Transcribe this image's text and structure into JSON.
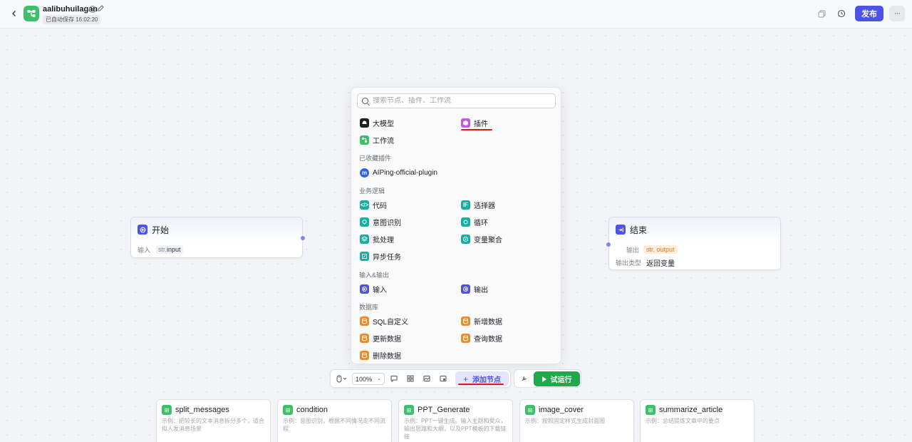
{
  "header": {
    "app_name": "aalibuhuilagan",
    "autosave": "已自动保存 16:02:20",
    "publish_label": "发布",
    "more_label": "···"
  },
  "colors": {
    "brand": "#4d53e8",
    "workflow_green": "#3ec06b",
    "run_green": "#20a84a",
    "annotation_red": "#e01818"
  },
  "start_node": {
    "title": "开始",
    "input_label": "输入",
    "input_type": "str.",
    "input_name": "input"
  },
  "end_node": {
    "title": "结束",
    "output_label": "输出",
    "output_tag": "output",
    "output_type_label": "输出类型",
    "output_type_value": "返回变量"
  },
  "popover": {
    "search_placeholder": "搜索节点、插件、工作流",
    "top_items": [
      {
        "label": "大模型",
        "icon": "llm-icon"
      },
      {
        "label": "插件",
        "icon": "plugin-icon"
      },
      {
        "label": "工作流",
        "icon": "workflow-icon"
      }
    ],
    "favorites_title": "已收藏插件",
    "favorite_plugin": "AIPing-official-plugin",
    "logic_title": "业务逻辑",
    "logic_items": [
      "代码",
      "选择器",
      "意图识别",
      "循环",
      "批处理",
      "变量聚合",
      "异步任务"
    ],
    "io_title": "输入&输出",
    "io_items": [
      "输入",
      "输出"
    ],
    "db_title": "数据库",
    "db_items": [
      "SQL自定义",
      "新增数据",
      "更新数据",
      "查询数据",
      "删除数据"
    ]
  },
  "toolbar": {
    "zoom": "100%",
    "add_node_label": "添加节点",
    "run_label": "试运行"
  },
  "workflows": [
    {
      "name": "split_messages",
      "desc": "示例：把较长的文本消息拆分多个，适合拟人发消息场景"
    },
    {
      "name": "condition",
      "desc": "示例：意图识别，根据不同情况走不同流程"
    },
    {
      "name": "PPT_Generate",
      "desc": "示例：PPT一键生成。输入主题和受众，输出思路和大纲，以及PPT模板的下载链接"
    },
    {
      "name": "image_cover",
      "desc": "示例：按照固定样式生成封面图"
    },
    {
      "name": "summarize_article",
      "desc": "示例：总结提炼文章中的要点"
    }
  ]
}
